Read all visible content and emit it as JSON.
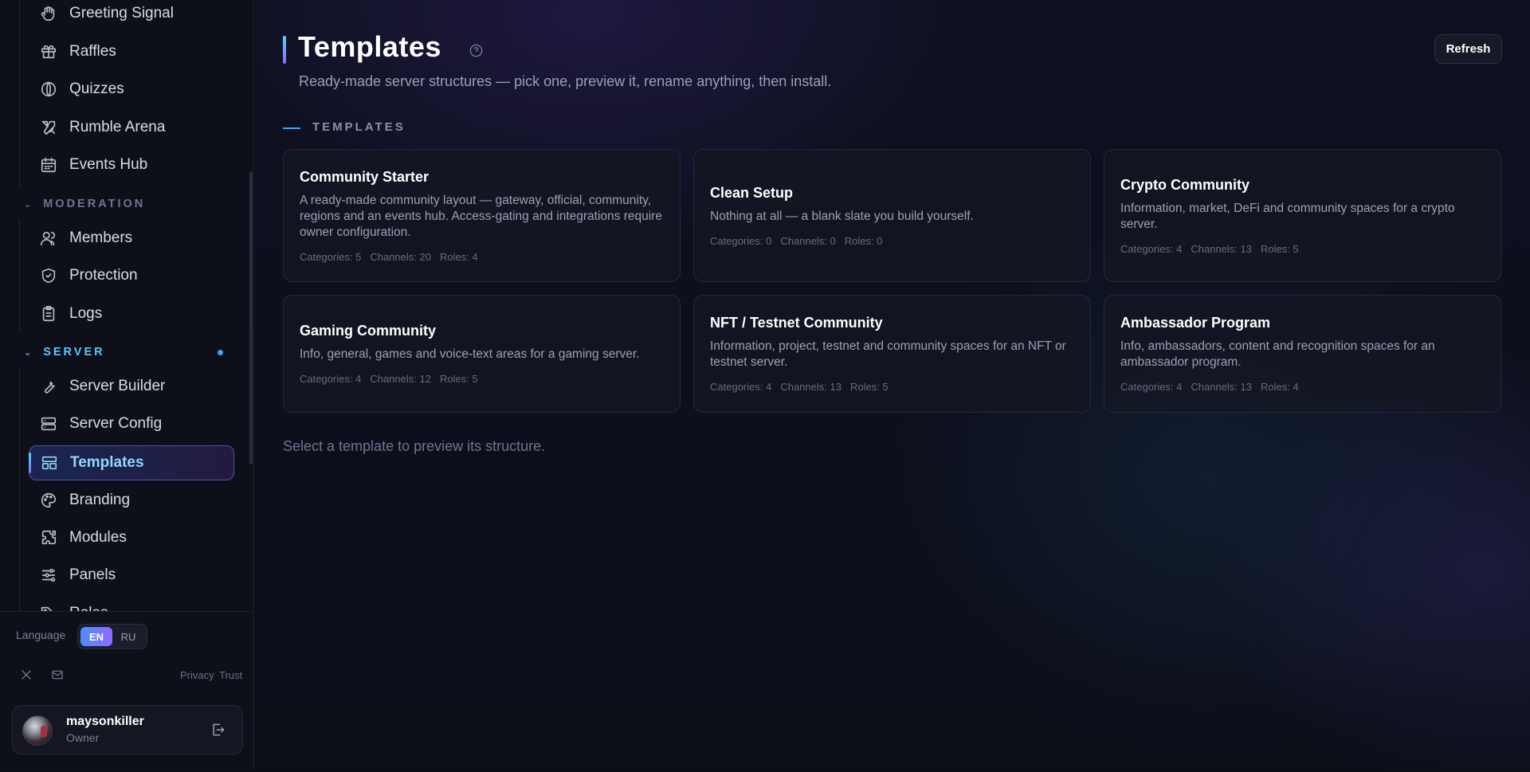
{
  "sidebar": {
    "items_top": [
      {
        "label": "Greeting Signal",
        "icon": "hand-icon"
      },
      {
        "label": "Raffles",
        "icon": "gift-icon"
      },
      {
        "label": "Quizzes",
        "icon": "brain-icon"
      },
      {
        "label": "Rumble Arena",
        "icon": "swords-icon"
      },
      {
        "label": "Events Hub",
        "icon": "calendar-icon"
      }
    ],
    "moderation": {
      "title": "MODERATION",
      "items": [
        {
          "label": "Members",
          "icon": "users-icon"
        },
        {
          "label": "Protection",
          "icon": "shield-icon"
        },
        {
          "label": "Logs",
          "icon": "clipboard-icon"
        }
      ]
    },
    "server": {
      "title": "SERVER",
      "items": [
        {
          "label": "Server Builder",
          "icon": "wrench-icon"
        },
        {
          "label": "Server Config",
          "icon": "server-icon"
        },
        {
          "label": "Templates",
          "icon": "layout-icon"
        },
        {
          "label": "Branding",
          "icon": "palette-icon"
        },
        {
          "label": "Modules",
          "icon": "puzzle-icon"
        },
        {
          "label": "Panels",
          "icon": "sliders-icon"
        },
        {
          "label": "Roles",
          "icon": "tag-icon"
        }
      ]
    },
    "language": {
      "label": "Language",
      "en": "EN",
      "ru": "RU",
      "active": "EN"
    },
    "footer_links": {
      "privacy": "Privacy",
      "trust": "Trust"
    },
    "user": {
      "name": "maysonkiller",
      "role": "Owner"
    }
  },
  "main": {
    "title": "Templates",
    "subtitle": "Ready-made server structures — pick one, preview it, rename anything, then install.",
    "refresh_label": "Refresh",
    "section_title": "TEMPLATES",
    "cards": [
      {
        "title": "Community Starter",
        "desc": "A ready-made community layout — gateway, official, community, regions and an events hub. Access-gating and integrations require owner configuration.",
        "categories": "Categories: 5",
        "channels": "Channels: 20",
        "roles": "Roles: 4"
      },
      {
        "title": "Clean Setup",
        "desc": "Nothing at all — a blank slate you build yourself.",
        "categories": "Categories: 0",
        "channels": "Channels: 0",
        "roles": "Roles: 0"
      },
      {
        "title": "Crypto Community",
        "desc": "Information, market, DeFi and community spaces for a crypto server.",
        "categories": "Categories: 4",
        "channels": "Channels: 13",
        "roles": "Roles: 5"
      },
      {
        "title": "Gaming Community",
        "desc": "Info, general, games and voice-text areas for a gaming server.",
        "categories": "Categories: 4",
        "channels": "Channels: 12",
        "roles": "Roles: 5"
      },
      {
        "title": "NFT / Testnet Community",
        "desc": "Information, project, testnet and community spaces for an NFT or testnet server.",
        "categories": "Categories: 4",
        "channels": "Channels: 13",
        "roles": "Roles: 5"
      },
      {
        "title": "Ambassador Program",
        "desc": "Info, ambassadors, content and recognition spaces for an ambassador program.",
        "categories": "Categories: 4",
        "channels": "Channels: 13",
        "roles": "Roles: 4"
      }
    ],
    "hint": "Select a template to preview its structure."
  },
  "colors": {
    "accent": "#5ad0ff",
    "accent2": "#8a6cff",
    "background": "#0b0d15"
  }
}
